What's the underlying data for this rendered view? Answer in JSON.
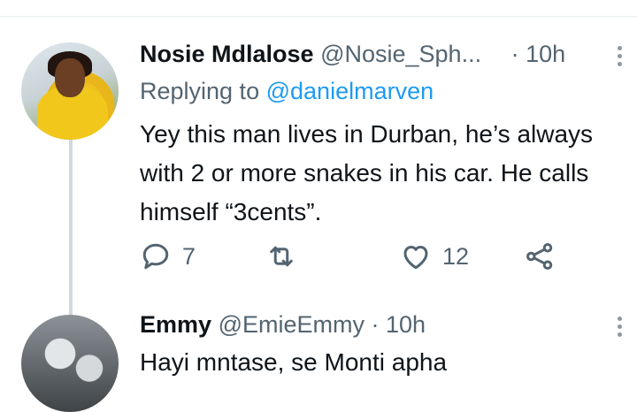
{
  "tweets": [
    {
      "display_name": "Nosie Mdlalose",
      "handle": "@Nosie_Sph...",
      "separator": "·",
      "time": "10h",
      "replying_prefix": "Replying to",
      "replying_handle": "@danielmarven",
      "text_lines": [
        "Yey this man lives in Durban, he’s always",
        "with 2 or more snakes in his car. He calls",
        "himself “3cents”."
      ],
      "reply_count": "7",
      "retweet_count": "",
      "like_count": "12"
    },
    {
      "display_name": "Emmy",
      "handle": "@EmieEmmy",
      "separator": "·",
      "time": "10h",
      "text_lines": [
        "Hayi mntase, se Monti apha"
      ]
    }
  ],
  "icons": {
    "reply": "reply-bubble-icon",
    "retweet": "retweet-icon",
    "like": "heart-icon",
    "share": "share-icon",
    "more": "more-vertical-icon"
  },
  "colors": {
    "text": "#0f1419",
    "muted": "#536471",
    "link": "#1d9bf0",
    "thread": "#cfd9de"
  }
}
